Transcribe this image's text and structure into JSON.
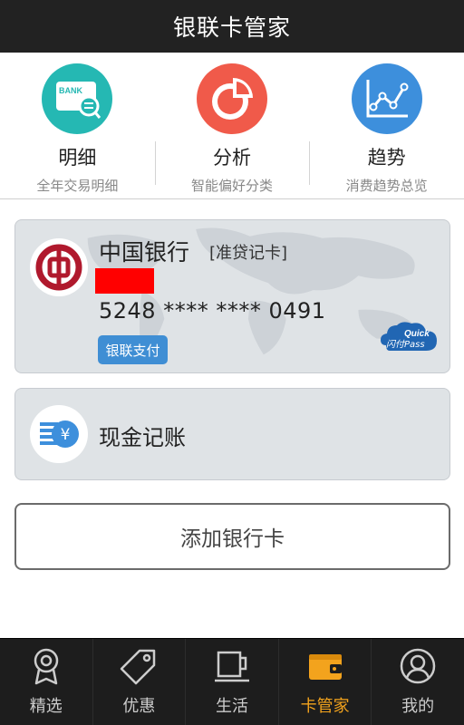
{
  "header": {
    "title": "银联卡管家"
  },
  "quick_actions": [
    {
      "title": "明细",
      "subtitle": "全年交易明细",
      "icon": "bank-search-icon",
      "icon_color": "#25b8b3",
      "icon_text": "BANK"
    },
    {
      "title": "分析",
      "subtitle": "智能偏好分类",
      "icon": "pie-chart-icon",
      "icon_color": "#f05a4a"
    },
    {
      "title": "趋势",
      "subtitle": "消费趋势总览",
      "icon": "line-chart-icon",
      "icon_color": "#3d8fdc"
    }
  ],
  "bank_card": {
    "bank_name": "中国银行",
    "card_type": "[准贷记卡]",
    "card_number": "5248 **** **** 0491",
    "unionpay_label": "银联支付",
    "quickpass": {
      "top": "Quick",
      "bottom": "闪付Pass"
    },
    "logo_color": "#b0192d"
  },
  "cash_card": {
    "label": "现金记账",
    "icon": "cash-yuan-icon",
    "icon_color": "#3d8fdc"
  },
  "add_card": {
    "label": "添加银行卡"
  },
  "tabs": [
    {
      "label": "精选",
      "icon": "badge-icon",
      "active": false
    },
    {
      "label": "优惠",
      "icon": "tag-icon",
      "active": false
    },
    {
      "label": "生活",
      "icon": "cup-icon",
      "active": false
    },
    {
      "label": "卡管家",
      "icon": "wallet-icon",
      "active": true
    },
    {
      "label": "我的",
      "icon": "user-icon",
      "active": false
    }
  ],
  "colors": {
    "header_bg": "#222222",
    "accent": "#f3a31d",
    "tabbar_bg": "#1d1d1d"
  }
}
